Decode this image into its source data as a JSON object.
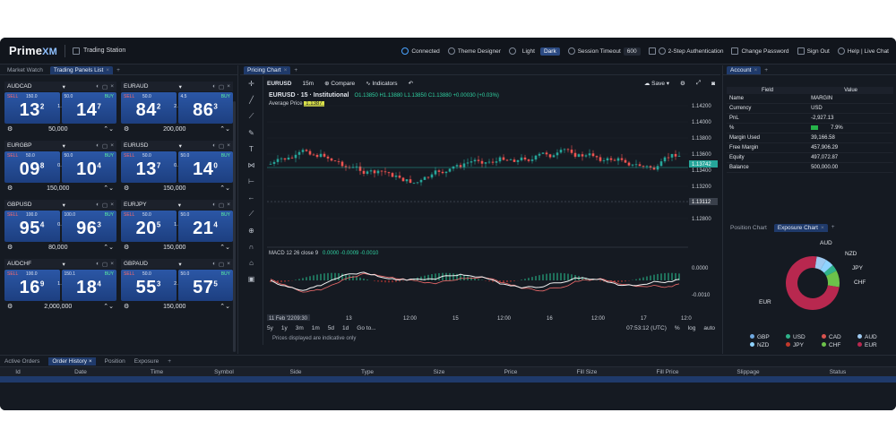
{
  "app": {
    "logo": "Prime",
    "logo_suffix": "XM",
    "station": "Trading Station"
  },
  "topbar": {
    "connected": "Connected",
    "theme_designer": "Theme Designer",
    "light": "Light",
    "dark": "Dark",
    "session_timeout_label": "Session Timeout",
    "session_timeout_value": "600",
    "two_step": "2-Step Authentication",
    "change_password": "Change Password",
    "sign_out": "Sign Out",
    "help": "Help | Live Chat"
  },
  "left": {
    "tabs": [
      "Market Watch",
      "Trading Panels List"
    ],
    "tiles": [
      {
        "symbol": "AUDCAD",
        "sell_px": "150.0",
        "spread": "1.5",
        "buy_px": "50.0",
        "sell_big": "13",
        "sell_sup": "2",
        "buy_big": "14",
        "buy_sup": "7",
        "amount": "50,000"
      },
      {
        "symbol": "EURAUD",
        "sell_px": "50.0",
        "spread": "2.1",
        "buy_px": "4.5",
        "sell_big": "84",
        "sell_sup": "2",
        "buy_big": "86",
        "buy_sup": "3",
        "amount": "200,000"
      },
      {
        "symbol": "EURGBP",
        "sell_px": "50.0",
        "spread": "0.5",
        "buy_px": "50.0",
        "sell_big": "09",
        "sell_sup": "8",
        "buy_big": "10",
        "buy_sup": "4",
        "amount": "150,000"
      },
      {
        "symbol": "EURUSD",
        "sell_px": "50.0",
        "spread": "0.8",
        "buy_px": "50.0",
        "sell_big": "13",
        "sell_sup": "7",
        "buy_big": "14",
        "buy_sup": "0",
        "amount": "150,000"
      },
      {
        "symbol": "GBPUSD",
        "sell_px": "100.0",
        "spread": "0.9",
        "buy_px": "100.0",
        "sell_big": "95",
        "sell_sup": "4",
        "buy_big": "96",
        "buy_sup": "3",
        "amount": "80,000"
      },
      {
        "symbol": "EURJPY",
        "sell_px": "50.0",
        "spread": "1.5",
        "buy_px": "50.0",
        "sell_big": "20",
        "sell_sup": "5",
        "buy_big": "21",
        "buy_sup": "4",
        "amount": "150,000"
      },
      {
        "symbol": "AUDCHF",
        "sell_px": "100.0",
        "spread": "1.5",
        "buy_px": "150.1",
        "sell_big": "16",
        "sell_sup": "9",
        "buy_big": "18",
        "buy_sup": "4",
        "amount": "2,000,000"
      },
      {
        "symbol": "GBPAUD",
        "sell_px": "50.0",
        "spread": "2.2",
        "buy_px": "50.0",
        "sell_big": "55",
        "sell_sup": "3",
        "buy_big": "57",
        "buy_sup": "5",
        "amount": "150,000"
      }
    ],
    "sell": "SELL",
    "buy": "BUY"
  },
  "center": {
    "tab": "Pricing Chart",
    "symbol": "EURUSD",
    "timeframe": "15m",
    "compare": "Compare",
    "indicators": "Indicators",
    "save": "Save",
    "title": "EURUSD · 15 · Institutional",
    "ohlc": "O1.13850 H1.13880 L1.13850 C1.13880 +0.00030 (+0.03%)",
    "avg_price": "Average Price",
    "avg_value": "1.1387",
    "macd_label": "MACD 12 26 close 9",
    "macd_values": "0.0000  -0.0009  -0.0010",
    "price_ticks": [
      "1.14200",
      "1.14000",
      "1.13800",
      "1.13600",
      "1.13400",
      "1.13200",
      "1.13000",
      "1.12800"
    ],
    "current_price": "1.13742",
    "level_price": "1.13112",
    "macd_ticks": [
      "0.0000",
      "-0.0010"
    ],
    "x_ticks": [
      "11 Feb '22",
      "09:30",
      "13",
      "12:00",
      "15",
      "12:00",
      "16",
      "12:00",
      "17",
      "12:0"
    ],
    "ranges": [
      "5y",
      "1y",
      "3m",
      "1m",
      "5d",
      "1d",
      "Go to..."
    ],
    "clock": "07:53:12 (UTC)",
    "pct": "%",
    "log": "log",
    "auto": "auto",
    "note": "Prices displayed are indicative only"
  },
  "right": {
    "tab": "Account",
    "columns": [
      "Field",
      "Value"
    ],
    "rows": [
      {
        "field": "Name",
        "value": "MARGIN"
      },
      {
        "field": "Currency",
        "value": "USD"
      },
      {
        "field": "PnL",
        "value": "-2,927.13"
      },
      {
        "field": "%",
        "value": "7.9%"
      },
      {
        "field": "Margin Used",
        "value": "39,166.58"
      },
      {
        "field": "Free Margin",
        "value": "457,906.29"
      },
      {
        "field": "Equity",
        "value": "497,072.87"
      },
      {
        "field": "Balance",
        "value": "500,000.00"
      }
    ],
    "chart_tabs": [
      "Position Chart",
      "Exposure Chart"
    ],
    "pie_labels": [
      "AUD",
      "NZD",
      "JPY",
      "CHF",
      "EUR"
    ],
    "legend": [
      {
        "name": "GBP",
        "color": "#6fa8e0"
      },
      {
        "name": "USD",
        "color": "#2fb28a"
      },
      {
        "name": "CAD",
        "color": "#d9534f"
      },
      {
        "name": "AUD",
        "color": "#9ec9f0"
      },
      {
        "name": "NZD",
        "color": "#8fd3ff"
      },
      {
        "name": "JPY",
        "color": "#c0392b"
      },
      {
        "name": "CHF",
        "color": "#6cc24a"
      },
      {
        "name": "EUR",
        "color": "#b8284f"
      }
    ]
  },
  "bottom": {
    "tabs": [
      "Active Orders",
      "Order History",
      "Position",
      "Exposure"
    ],
    "columns": [
      "Id",
      "Date",
      "Time",
      "Symbol",
      "Side",
      "Type",
      "Size",
      "Price",
      "Fill Size",
      "Fill Price",
      "Slippage",
      "Status"
    ]
  }
}
